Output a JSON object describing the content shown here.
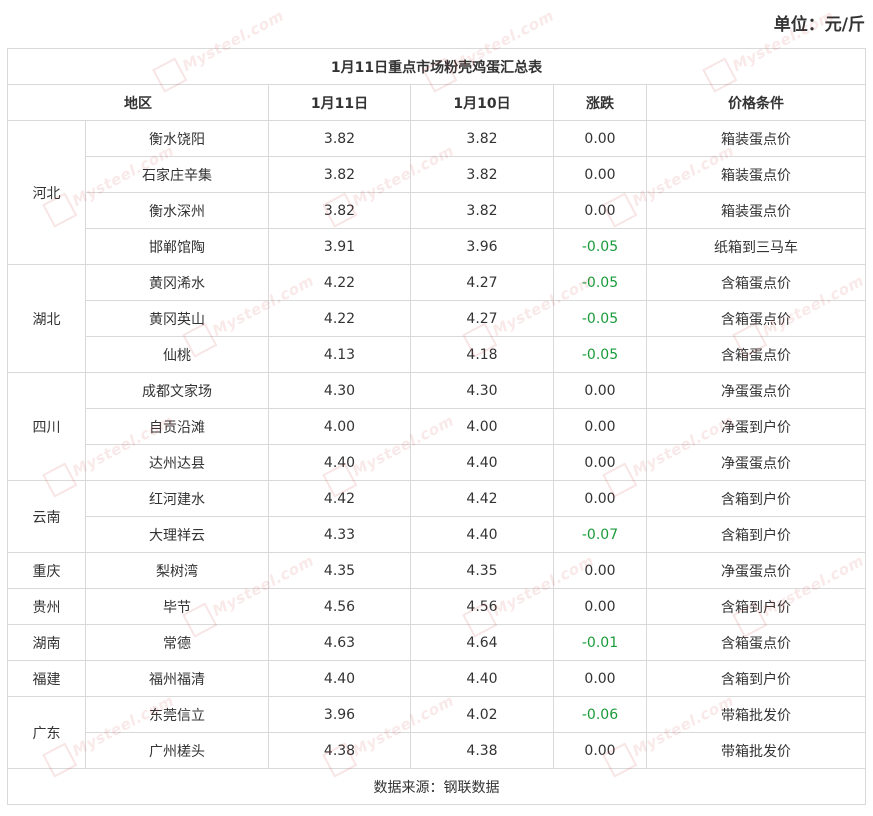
{
  "unit_label": "单位：元/斤",
  "table": {
    "title": "1月11日重点市场粉壳鸡蛋汇总表",
    "headers": {
      "region": "地区",
      "jan11": "1月11日",
      "jan10": "1月10日",
      "change": "涨跌",
      "condition": "价格条件"
    },
    "groups": [
      {
        "province": "河北",
        "rows": [
          {
            "market": "衡水饶阳",
            "jan11": "3.82",
            "jan10": "3.82",
            "change": "0.00",
            "condition": "箱装蛋点价"
          },
          {
            "market": "石家庄辛集",
            "jan11": "3.82",
            "jan10": "3.82",
            "change": "0.00",
            "condition": "箱装蛋点价"
          },
          {
            "market": "衡水深州",
            "jan11": "3.82",
            "jan10": "3.82",
            "change": "0.00",
            "condition": "箱装蛋点价"
          },
          {
            "market": "邯郸馆陶",
            "jan11": "3.91",
            "jan10": "3.96",
            "change": "-0.05",
            "condition": "纸箱到三马车"
          }
        ]
      },
      {
        "province": "湖北",
        "rows": [
          {
            "market": "黄冈浠水",
            "jan11": "4.22",
            "jan10": "4.27",
            "change": "-0.05",
            "condition": "含箱蛋点价"
          },
          {
            "market": "黄冈英山",
            "jan11": "4.22",
            "jan10": "4.27",
            "change": "-0.05",
            "condition": "含箱蛋点价"
          },
          {
            "market": "仙桃",
            "jan11": "4.13",
            "jan10": "4.18",
            "change": "-0.05",
            "condition": "含箱蛋点价"
          }
        ]
      },
      {
        "province": "四川",
        "rows": [
          {
            "market": "成都文家场",
            "jan11": "4.30",
            "jan10": "4.30",
            "change": "0.00",
            "condition": "净蛋蛋点价"
          },
          {
            "market": "自贡沿滩",
            "jan11": "4.00",
            "jan10": "4.00",
            "change": "0.00",
            "condition": "净蛋到户价"
          },
          {
            "market": "达州达县",
            "jan11": "4.40",
            "jan10": "4.40",
            "change": "0.00",
            "condition": "净蛋蛋点价"
          }
        ]
      },
      {
        "province": "云南",
        "rows": [
          {
            "market": "红河建水",
            "jan11": "4.42",
            "jan10": "4.42",
            "change": "0.00",
            "condition": "含箱到户价"
          },
          {
            "market": "大理祥云",
            "jan11": "4.33",
            "jan10": "4.40",
            "change": "-0.07",
            "condition": "含箱到户价"
          }
        ]
      },
      {
        "province": "重庆",
        "rows": [
          {
            "market": "梨树湾",
            "jan11": "4.35",
            "jan10": "4.35",
            "change": "0.00",
            "condition": "净蛋蛋点价"
          }
        ]
      },
      {
        "province": "贵州",
        "rows": [
          {
            "market": "毕节",
            "jan11": "4.56",
            "jan10": "4.56",
            "change": "0.00",
            "condition": "含箱到户价"
          }
        ]
      },
      {
        "province": "湖南",
        "rows": [
          {
            "market": "常德",
            "jan11": "4.63",
            "jan10": "4.64",
            "change": "-0.01",
            "condition": "含箱蛋点价"
          }
        ]
      },
      {
        "province": "福建",
        "rows": [
          {
            "market": "福州福清",
            "jan11": "4.40",
            "jan10": "4.40",
            "change": "0.00",
            "condition": "含箱到户价"
          }
        ]
      },
      {
        "province": "广东",
        "rows": [
          {
            "market": "东莞信立",
            "jan11": "3.96",
            "jan10": "4.02",
            "change": "-0.06",
            "condition": "带箱批发价"
          },
          {
            "market": "广州槎头",
            "jan11": "4.38",
            "jan10": "4.38",
            "change": "0.00",
            "condition": "带箱批发价"
          }
        ]
      }
    ],
    "source": "数据来源：钢联数据"
  },
  "watermark": "Mysteel.com",
  "colors": {
    "negative_change": "#1a9b3a",
    "border": "#d9d9d9",
    "text": "#333333"
  }
}
